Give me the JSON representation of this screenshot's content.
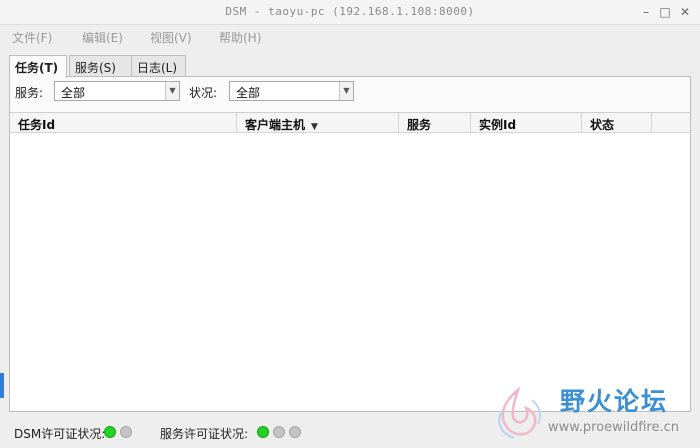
{
  "window": {
    "title": "DSM - taoyu-pc (192.168.1.108:8000)"
  },
  "menu": [
    {
      "label": "文件(F)"
    },
    {
      "label": "编辑(E)"
    },
    {
      "label": "视图(V)"
    },
    {
      "label": "帮助(H)"
    }
  ],
  "tabs": [
    {
      "label": "任务(T)",
      "active": true
    },
    {
      "label": "服务(S)",
      "active": false
    },
    {
      "label": "日志(L)",
      "active": false
    }
  ],
  "filters": {
    "service_label": "服务:",
    "service_value": "全部",
    "status_label": "状况:",
    "status_value": "全部"
  },
  "table": {
    "columns": [
      "任务Id",
      "客户端主机",
      "服务",
      "实例Id",
      "状态"
    ],
    "sorted_column": "客户端主机",
    "rows": []
  },
  "status": {
    "dsm_license_label": "DSM许可证状况:",
    "service_license_label": "服务许可证状况:",
    "colors": {
      "on": "#22d322",
      "off": "#c4c4c4"
    }
  },
  "watermark": {
    "title": "野火论坛",
    "url": "www.proewildfire.cn"
  }
}
